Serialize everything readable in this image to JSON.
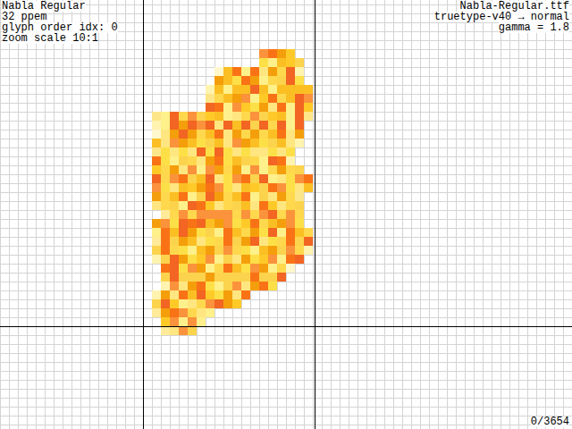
{
  "font_info": [
    "Nabla Regular",
    "32 ppem",
    "glyph order idx: 0",
    "zoom scale 10:1"
  ],
  "render_info": [
    "Nabla-Regular.ttf",
    "truetype-v40 → normal",
    "gamma = 1.8"
  ],
  "glyph_counter": "0/3654"
}
